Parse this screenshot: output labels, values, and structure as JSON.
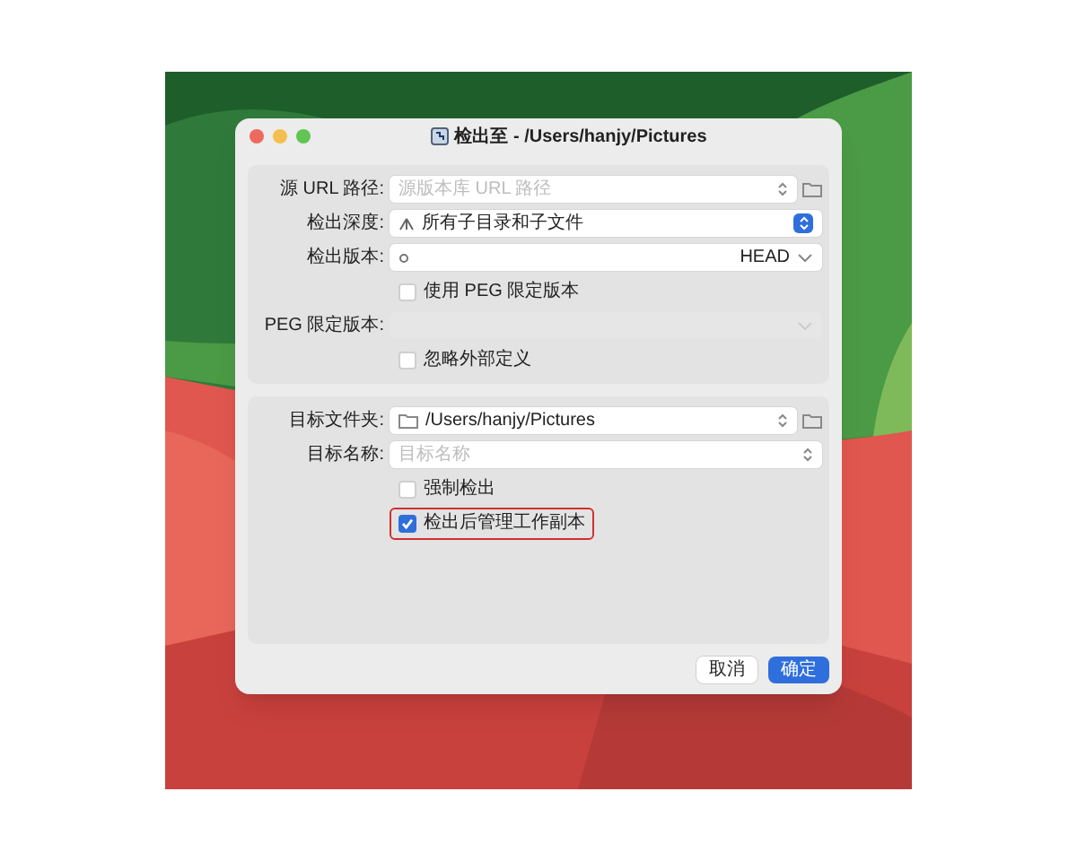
{
  "window": {
    "title": "检出至 - /Users/hanjy/Pictures"
  },
  "sections": [
    {
      "rows": [
        {
          "kind": "path",
          "label": "源 URL 路径:",
          "placeholder": "源版本库 URL 路径"
        },
        {
          "kind": "popup",
          "label": "检出深度:",
          "value": "所有子目录和子文件"
        },
        {
          "kind": "revision",
          "label": "检出版本:",
          "value": "HEAD"
        },
        {
          "kind": "checkbox",
          "label": "使用 PEG 限定版本",
          "checked": false,
          "highlighted": false
        },
        {
          "kind": "disabled",
          "label": "PEG 限定版本:"
        },
        {
          "kind": "checkbox",
          "label": "忽略外部定义",
          "checked": false,
          "highlighted": false
        }
      ]
    },
    {
      "rows": [
        {
          "kind": "path",
          "label": "目标文件夹:",
          "value": "/Users/hanjy/Pictures"
        },
        {
          "kind": "name",
          "label": "目标名称:",
          "placeholder": "目标名称"
        },
        {
          "kind": "checkbox",
          "label": "强制检出",
          "checked": false,
          "highlighted": false
        },
        {
          "kind": "checkbox",
          "label": "检出后管理工作副本",
          "checked": true,
          "highlighted": true
        }
      ]
    }
  ],
  "buttons": [
    {
      "label": "取消",
      "default": false
    },
    {
      "label": "确定",
      "default": true
    }
  ]
}
